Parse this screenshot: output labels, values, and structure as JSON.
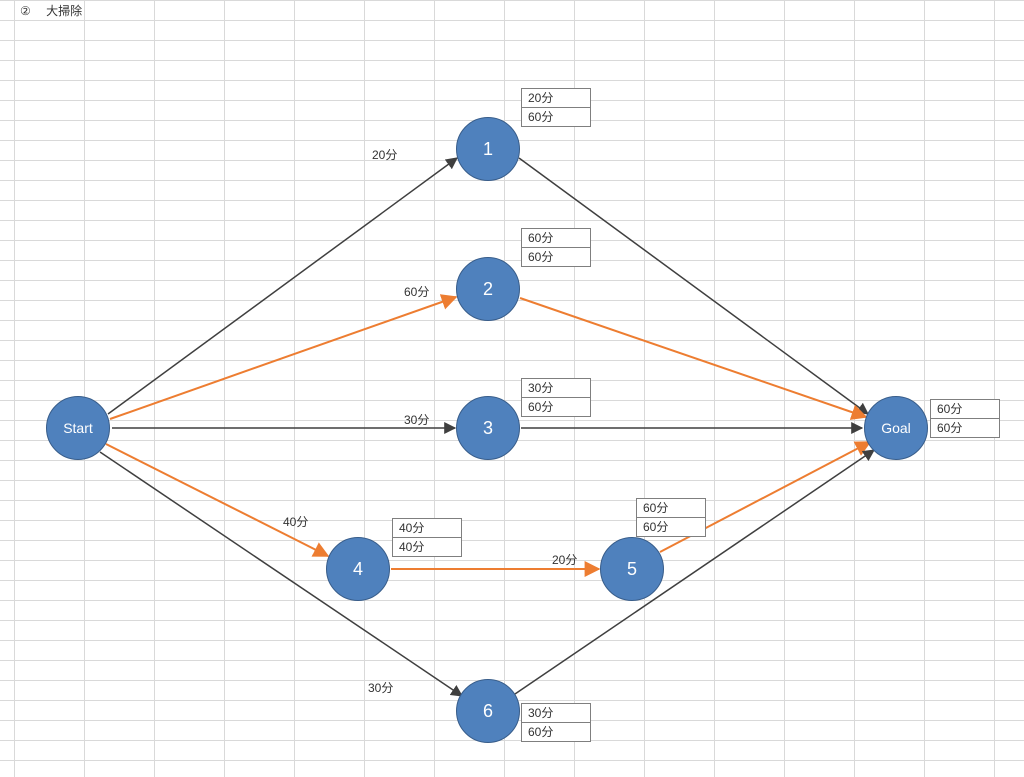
{
  "title": {
    "marker": "②",
    "text": "大掃除"
  },
  "nodes": {
    "start": {
      "label": "Start"
    },
    "n1": {
      "label": "1"
    },
    "n2": {
      "label": "2"
    },
    "n3": {
      "label": "3"
    },
    "n4": {
      "label": "4"
    },
    "n5": {
      "label": "5"
    },
    "n6": {
      "label": "6"
    },
    "goal": {
      "label": "Goal"
    }
  },
  "edges": {
    "s_1": {
      "label": "20分"
    },
    "s_2": {
      "label": "60分"
    },
    "s_3": {
      "label": "30分"
    },
    "s_4": {
      "label": "40分"
    },
    "s_6": {
      "label": "30分"
    },
    "4_5": {
      "label": "20分"
    }
  },
  "box": {
    "n1": {
      "top": "20分",
      "bot": "60分"
    },
    "n2": {
      "top": "60分",
      "bot": "60分"
    },
    "n3": {
      "top": "30分",
      "bot": "60分"
    },
    "n4": {
      "top": "40分",
      "bot": "40分"
    },
    "n5": {
      "top": "60分",
      "bot": "60分"
    },
    "n6": {
      "top": "30分",
      "bot": "60分"
    },
    "goal": {
      "top": "60分",
      "bot": "60分"
    }
  },
  "chart_data": {
    "type": "diagram",
    "description": "PERT-style arrow diagram for 大掃除 (big cleaning). Circles are activities; arrows show precedence with durations; two-row boxes beside nodes show earliest/latest times. Orange arrows mark the critical path.",
    "nodes": [
      "Start",
      "1",
      "2",
      "3",
      "4",
      "5",
      "6",
      "Goal"
    ],
    "edges": [
      {
        "from": "Start",
        "to": "1",
        "duration": "20分",
        "critical": false
      },
      {
        "from": "Start",
        "to": "2",
        "duration": "60分",
        "critical": true
      },
      {
        "from": "Start",
        "to": "3",
        "duration": "30分",
        "critical": false
      },
      {
        "from": "Start",
        "to": "4",
        "duration": "40分",
        "critical": true
      },
      {
        "from": "Start",
        "to": "6",
        "duration": "30分",
        "critical": false
      },
      {
        "from": "4",
        "to": "5",
        "duration": "20分",
        "critical": true
      },
      {
        "from": "1",
        "to": "Goal",
        "duration": null,
        "critical": false
      },
      {
        "from": "2",
        "to": "Goal",
        "duration": null,
        "critical": true
      },
      {
        "from": "3",
        "to": "Goal",
        "duration": null,
        "critical": false
      },
      {
        "from": "5",
        "to": "Goal",
        "duration": null,
        "critical": true
      },
      {
        "from": "6",
        "to": "Goal",
        "duration": null,
        "critical": false
      }
    ],
    "node_times": {
      "1": {
        "earliest": "20分",
        "latest": "60分"
      },
      "2": {
        "earliest": "60分",
        "latest": "60分"
      },
      "3": {
        "earliest": "30分",
        "latest": "60分"
      },
      "4": {
        "earliest": "40分",
        "latest": "40分"
      },
      "5": {
        "earliest": "60分",
        "latest": "60分"
      },
      "6": {
        "earliest": "30分",
        "latest": "60分"
      },
      "Goal": {
        "earliest": "60分",
        "latest": "60分"
      }
    },
    "critical_path": [
      [
        "Start",
        "2",
        "Goal"
      ],
      [
        "Start",
        "4",
        "5",
        "Goal"
      ]
    ]
  }
}
